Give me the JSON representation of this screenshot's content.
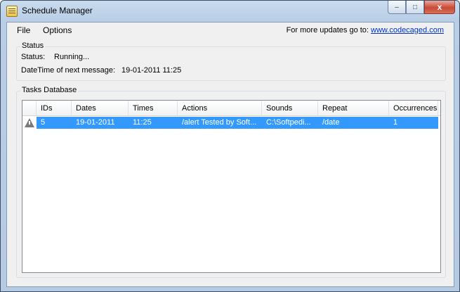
{
  "window": {
    "title": "Schedule Manager",
    "controls": {
      "minimize": "–",
      "maximize": "□",
      "close": "x"
    }
  },
  "menu": {
    "file": "File",
    "options": "Options"
  },
  "updates": {
    "prefix": "For more updates go to:",
    "link": "www.codecaged.com"
  },
  "status": {
    "group_label": "Status",
    "status_label": "Status:",
    "status_value": "Running...",
    "next_label": "DateTime of next message:",
    "next_value": "19-01-2011 11:25"
  },
  "tasks": {
    "group_label": "Tasks Database",
    "columns": [
      "IDs",
      "Dates",
      "Times",
      "Actions",
      "Sounds",
      "Repeat",
      "Occurrences"
    ],
    "rows": [
      [
        "5",
        "19-01-2011",
        "11:25",
        "/alert Tested by Soft...",
        "C:\\Softpedi...",
        "/date",
        "1"
      ]
    ]
  },
  "colors": {
    "selection": "#3399ff",
    "link": "#0033cc"
  },
  "icons": {
    "row_icon": "warning-triangle-icon",
    "app_icon": "schedule-app-icon"
  }
}
